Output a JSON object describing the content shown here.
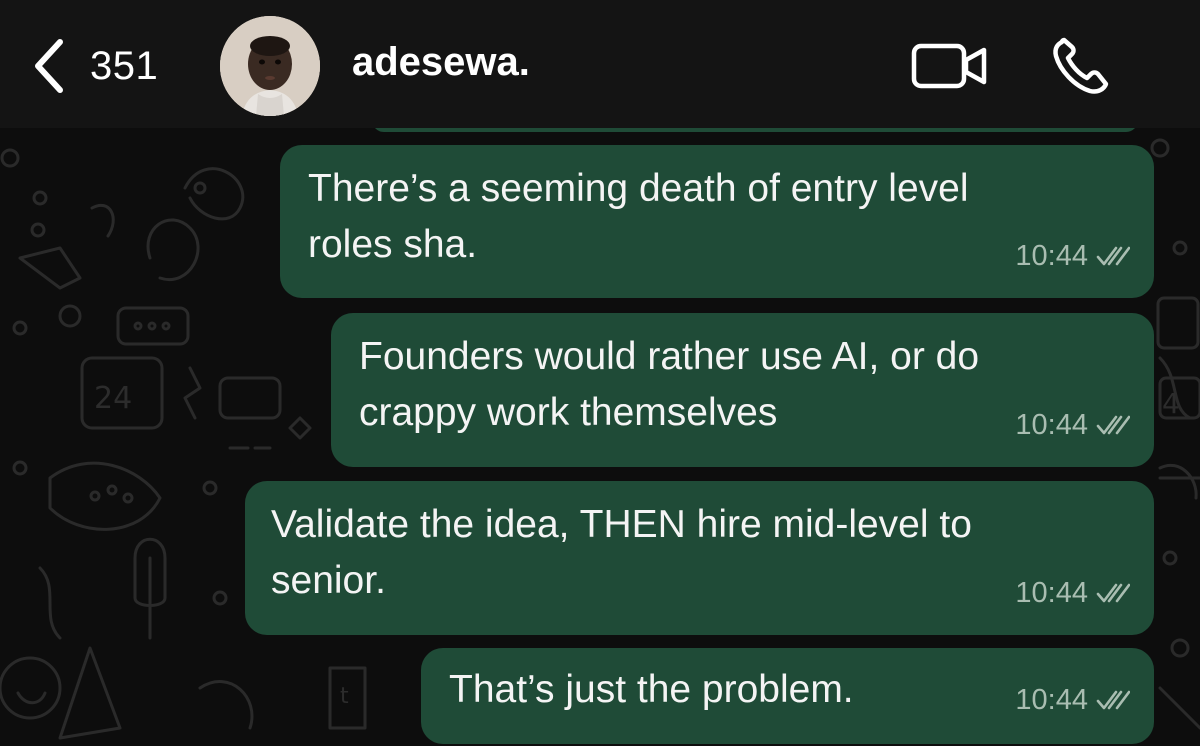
{
  "header": {
    "back_count": "351",
    "contact_name": "adesewa.",
    "icons": {
      "back": "chevron-left-icon",
      "video": "video-camera-icon",
      "phone": "phone-icon"
    },
    "colors": {
      "header_bg": "#141414",
      "text": "#ffffff"
    }
  },
  "chat": {
    "colors": {
      "background": "#0d0d0d",
      "outgoing_bubble": "#1f4b37",
      "meta_text": "#a9bdb1"
    },
    "messages": [
      {
        "text": "There’s a seeming death of entry level\nroles sha.",
        "time": "10:44",
        "status": "double-check-icon"
      },
      {
        "text": "Founders would rather use AI, or do\ncrappy work themselves",
        "time": "10:44",
        "status": "double-check-icon"
      },
      {
        "text": "Validate the idea, THEN hire mid-level to\nsenior.",
        "time": "10:44",
        "status": "double-check-icon"
      },
      {
        "text": "That’s just the problem.",
        "time": "10:44",
        "status": "double-check-icon"
      }
    ]
  }
}
